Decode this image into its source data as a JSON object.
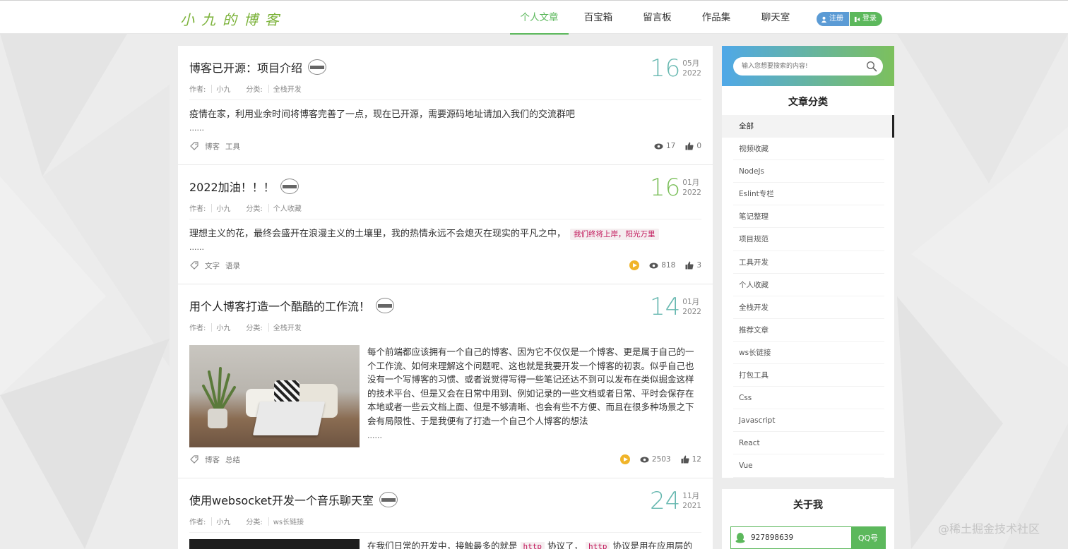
{
  "header": {
    "logo": "小九的博客",
    "nav": [
      {
        "label": "个人文章",
        "active": true
      },
      {
        "label": "百宝箱",
        "active": false
      },
      {
        "label": "留言板",
        "active": false
      },
      {
        "label": "作品集",
        "active": false
      },
      {
        "label": "聊天室",
        "active": false
      }
    ],
    "register_label": "注册",
    "login_label": "登录"
  },
  "labels": {
    "author": "作者:",
    "category": "分类:"
  },
  "articles": [
    {
      "title": "博客已开源：项目介绍",
      "author": "小九",
      "category": "全栈开发",
      "day": "16",
      "month": "05月",
      "year": "2022",
      "summary": "疫情在家，利用业余时间将博客完善了一点，现在已开源，需要源码地址请加入我们的交流群吧",
      "ellipsis": "......",
      "tags": [
        "博客",
        "工具"
      ],
      "views": "17",
      "likes": "0"
    },
    {
      "title": "2022加油！！！",
      "author": "小九",
      "category": "个人收藏",
      "day": "16",
      "month": "01月",
      "year": "2022",
      "summary": "理想主义的花，最终会盛开在浪漫主义的土壤里，我的热情永远不会熄灭在现实的平凡之中，",
      "highlight": "我们终将上岸，阳光万里",
      "ellipsis": "......",
      "tags": [
        "文字",
        "语录"
      ],
      "views": "818",
      "likes": "3"
    },
    {
      "title": "用个人博客打造一个酷酷的工作流！",
      "author": "小九",
      "category": "全栈开发",
      "day": "14",
      "month": "01月",
      "year": "2022",
      "summary": "每个前端都应该拥有一个自己的博客、因为它不仅仅是一个博客、更是属于自己的一个工作流、如何来理解这个问题呢、这也就是我要开发一个博客的初衷。似乎自己也没有一个写博客的习惯、或者说觉得写得一些笔记还达不到可以发布在类似掘金这样的技术平台、但是又会在日常中用到、例如记录的一些文档或者日常、平时会保存在本地或者一些云文档上面、但是不够清晰、也会有些不方便、而且在很多种场景之下会有局限性、于是我便有了打造一个自己个人博客的想法",
      "ellipsis": "......",
      "tags": [
        "博客",
        "总结"
      ],
      "views": "2503",
      "likes": "12"
    },
    {
      "title": "使用websocket开发一个音乐聊天室",
      "author": "小九",
      "category": "ws长链接",
      "day": "24",
      "month": "11月",
      "year": "2021",
      "summary_a": "在我们日常的开发中，接触最多的就是",
      "code_a": "http",
      "summary_b": "协议了，",
      "code_b": "http",
      "summary_c": "协议是用在应用层的"
    }
  ],
  "sidebar": {
    "search_placeholder": "输入您想要搜索的内容!",
    "category_title": "文章分类",
    "categories": [
      "全部",
      "视频收藏",
      "NodeJs",
      "Eslint专栏",
      "笔记整理",
      "项目规范",
      "工具开发",
      "个人收藏",
      "全栈开发",
      "推荐文章",
      "ws长链接",
      "打包工具",
      "Css",
      "Javascript",
      "React",
      "Vue"
    ],
    "about_title": "关于我",
    "qq_number": "927898639",
    "qq_button": "QQ号"
  },
  "watermark": "@稀土掘金技术社区",
  "colors": {
    "accent": "#5cb85c",
    "date": "#67b8b0",
    "link_blue": "#5b9bd5"
  },
  "icons": [
    "search-icon",
    "tag-icon",
    "eye-icon",
    "thumb-up-icon",
    "play-icon",
    "user-icon",
    "login-icon",
    "qq-penguin-icon"
  ]
}
